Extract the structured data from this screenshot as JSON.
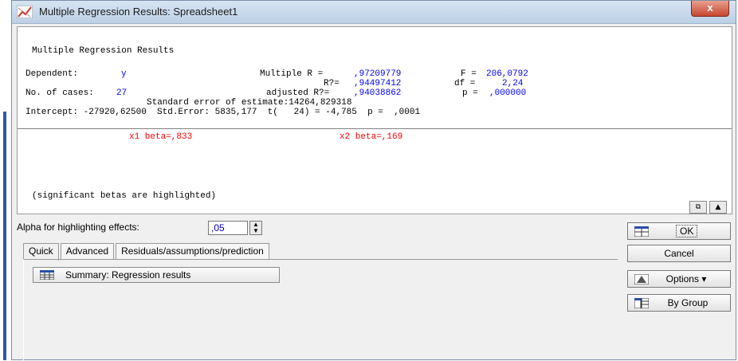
{
  "window": {
    "title": "Multiple Regression Results: Spreadsheet1",
    "close_glyph": "x"
  },
  "results": {
    "heading": "Multiple Regression Results",
    "dependent_label": "Dependent:",
    "dependent_value": "y",
    "multiple_r_label": "Multiple R =",
    "multiple_r_value": ",97209779",
    "f_label": "F =",
    "f_value": "206,0792",
    "r2_label": "R?=",
    "r2_value": ",94497412",
    "df_label": "df =",
    "df_value": "2,24",
    "cases_label": "No. of cases:",
    "cases_value": "27",
    "adj_r2_label": "adjusted R?=",
    "adj_r2_value": ",94038862",
    "p_label": "p =",
    "p_value": ",000000",
    "std_err_estimate": "Standard error of estimate:14264,829318",
    "intercept_line": "Intercept: -27920,62500  Std.Error: 5835,177  t(   24) = -4,785  p =  ,0001",
    "x1_beta": "x1 beta=,833",
    "x2_beta": "x2 beta=,169",
    "footer_note": "(significant betas are highlighted)"
  },
  "alpha": {
    "label": "Alpha for highlighting effects:",
    "value": ",05"
  },
  "tabs": [
    {
      "label": "Quick",
      "active": true
    },
    {
      "label": "Advanced",
      "active": false
    },
    {
      "label": "Residuals/assumptions/prediction",
      "active": false
    }
  ],
  "quick": {
    "summary_button": "Summary:  Regression results"
  },
  "buttons": {
    "ok": "OK",
    "cancel": "Cancel",
    "options": "Options",
    "by_group": "By Group"
  },
  "colors": {
    "blue_text": "#0000ff",
    "red_text": "#ff0000"
  }
}
